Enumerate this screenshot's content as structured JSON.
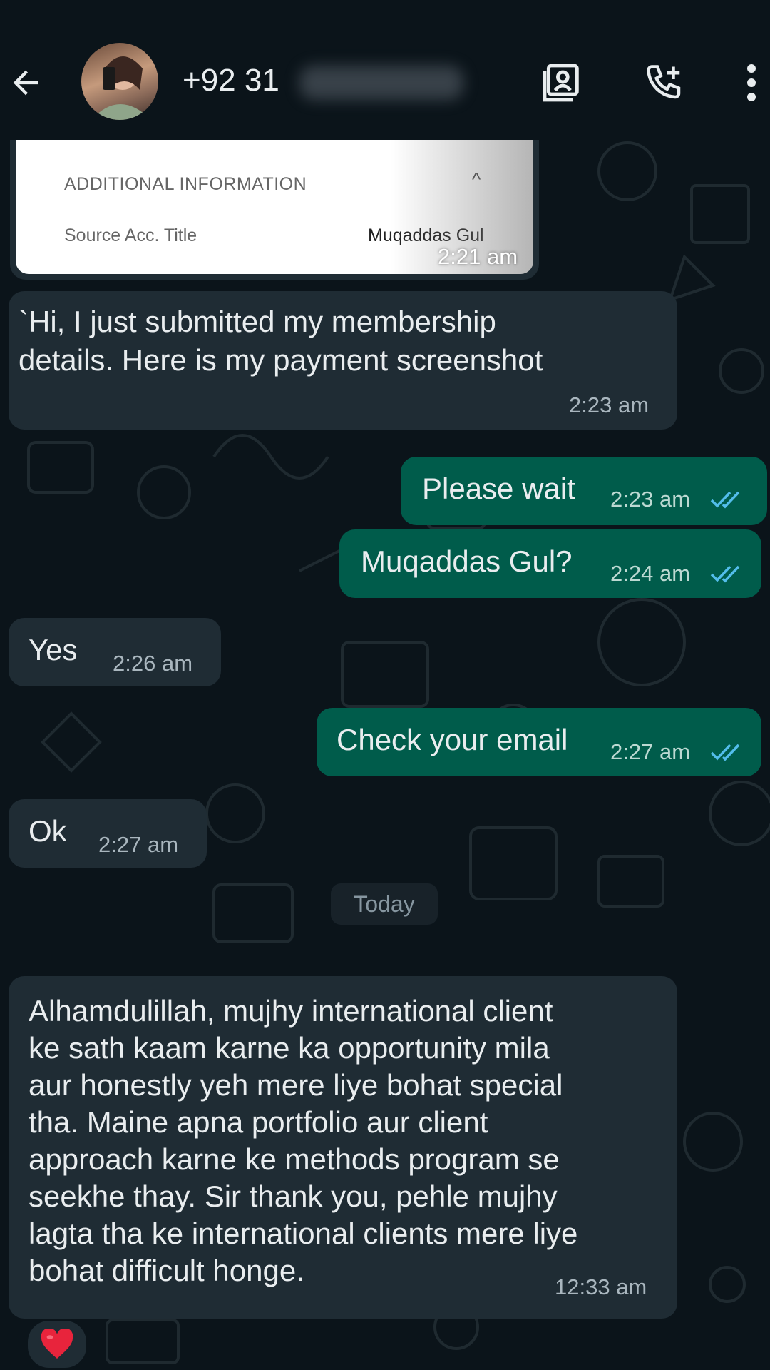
{
  "header": {
    "contact_name": "+92 31",
    "back_icon": "arrow-left-icon",
    "icons": [
      "contact-card-icon",
      "add-call-icon",
      "more-vert-icon"
    ]
  },
  "image_message": {
    "card_title": "ADDITIONAL INFORMATION",
    "card_chevron": "^",
    "card_label": "Source Acc. Title",
    "card_value": "Muqaddas Gul",
    "time": "2:21 am"
  },
  "messages": [
    {
      "direction": "incoming",
      "lines": [
        "`Hi, I just submitted my membership",
        "details. Here is my payment screenshot"
      ],
      "time": "2:23 am"
    },
    {
      "direction": "outgoing",
      "text": "Please wait",
      "time": "2:23 am",
      "read": true
    },
    {
      "direction": "outgoing",
      "text": "Muqaddas Gul?",
      "time": "2:24 am",
      "read": true
    },
    {
      "direction": "incoming",
      "text": "Yes",
      "time": "2:26 am"
    },
    {
      "direction": "outgoing",
      "text": "Check your email",
      "time": "2:27 am",
      "read": true
    },
    {
      "direction": "incoming",
      "text": "Ok",
      "time": "2:27 am"
    }
  ],
  "date_separator": "Today",
  "last_message": {
    "direction": "incoming",
    "lines": [
      "Alhamdulillah, mujhy international client",
      "ke sath kaam karne ka opportunity mila",
      "aur honestly yeh mere liye bohat special",
      "tha. Maine apna portfolio aur client",
      "approach karne ke methods program se",
      "seekhe thay. Sir thank you, pehle mujhy",
      "lagta tha ke international clients mere liye",
      "bohat difficult honge."
    ],
    "time": "12:33 am",
    "reaction": "heart-icon"
  },
  "colors": {
    "background": "#0b141a",
    "incoming_bubble": "#1f2c34",
    "outgoing_bubble": "#005c4b",
    "read_ticks": "#53bdeb"
  }
}
